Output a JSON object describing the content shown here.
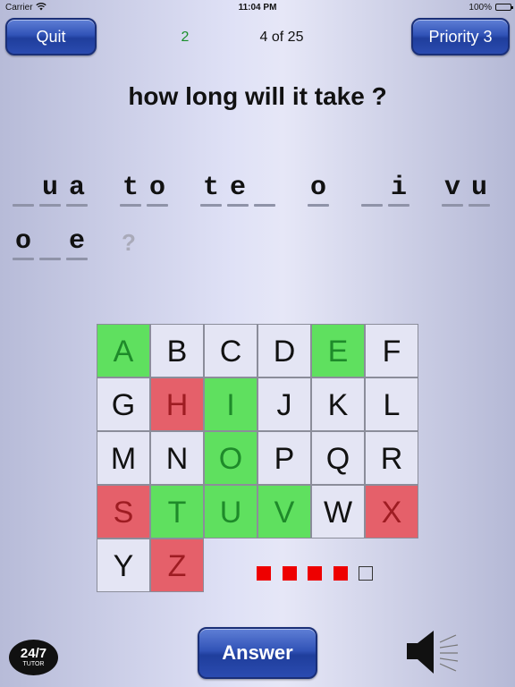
{
  "status_bar": {
    "carrier": "Carrier",
    "time": "11:04 PM",
    "battery": "100%"
  },
  "header": {
    "quit_label": "Quit",
    "score": "2",
    "progress": "4 of 25",
    "priority_label": "Priority 3"
  },
  "question": "how long will it take ?",
  "puzzle": {
    "line1": [
      "_",
      "u",
      "a",
      "",
      "t",
      "o",
      "",
      "t",
      "e",
      "_",
      "",
      "o",
      "",
      "_",
      "i",
      "",
      "v",
      "u"
    ],
    "line2": [
      "o",
      "_",
      "e"
    ],
    "hint": "?"
  },
  "keyboard": {
    "keys": [
      {
        "letter": "A",
        "state": "correct"
      },
      {
        "letter": "B",
        "state": "unused"
      },
      {
        "letter": "C",
        "state": "unused"
      },
      {
        "letter": "D",
        "state": "unused"
      },
      {
        "letter": "E",
        "state": "correct"
      },
      {
        "letter": "F",
        "state": "unused"
      },
      {
        "letter": "G",
        "state": "unused"
      },
      {
        "letter": "H",
        "state": "wrong"
      },
      {
        "letter": "I",
        "state": "correct"
      },
      {
        "letter": "J",
        "state": "unused"
      },
      {
        "letter": "K",
        "state": "unused"
      },
      {
        "letter": "L",
        "state": "unused"
      },
      {
        "letter": "M",
        "state": "unused"
      },
      {
        "letter": "N",
        "state": "unused"
      },
      {
        "letter": "O",
        "state": "correct"
      },
      {
        "letter": "P",
        "state": "unused"
      },
      {
        "letter": "Q",
        "state": "unused"
      },
      {
        "letter": "R",
        "state": "unused"
      },
      {
        "letter": "S",
        "state": "wrong"
      },
      {
        "letter": "T",
        "state": "correct"
      },
      {
        "letter": "U",
        "state": "correct"
      },
      {
        "letter": "V",
        "state": "correct"
      },
      {
        "letter": "W",
        "state": "unused"
      },
      {
        "letter": "X",
        "state": "wrong"
      },
      {
        "letter": "Y",
        "state": "unused"
      },
      {
        "letter": "Z",
        "state": "wrong"
      }
    ]
  },
  "lives": {
    "used": 4,
    "total": 5,
    "used_color": "#ee0000"
  },
  "footer": {
    "logo_main": "24/7",
    "logo_sub": "TUTOR",
    "answer_label": "Answer",
    "speaker_icon": "speaker-icon"
  },
  "colors": {
    "correct_bg": "#5fe05f",
    "correct_fg": "#1e8a2a",
    "wrong_bg": "#e5606a",
    "wrong_fg": "#9e1c22",
    "unused_bg": "#e4e5f4",
    "button_blue": "#3153b7"
  }
}
